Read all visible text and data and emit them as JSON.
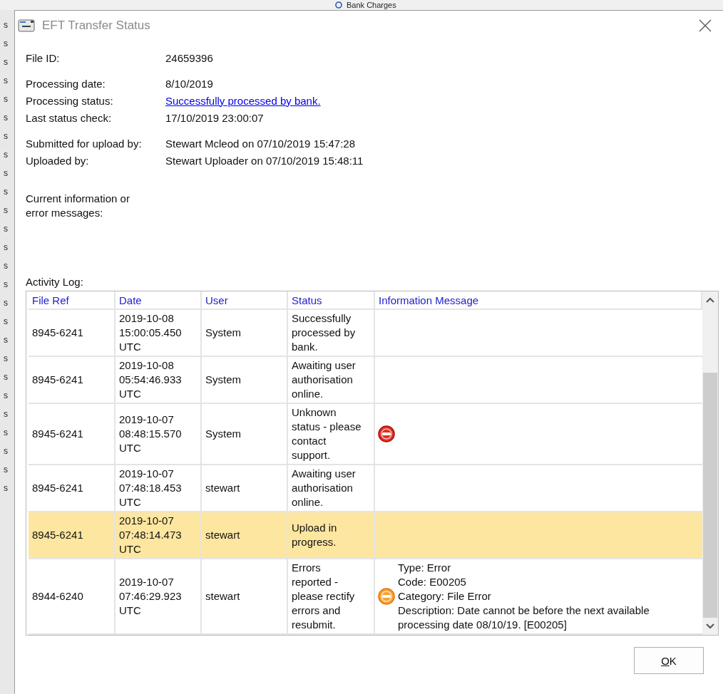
{
  "background_window": {
    "tab": "Bank Charges",
    "items": [
      "s",
      "s",
      "s",
      "s",
      "s",
      "s",
      "s",
      "s",
      "s",
      "s",
      "s",
      "s",
      "s",
      "s",
      "s",
      "s",
      "s",
      "s",
      "s",
      "s",
      "s",
      "s",
      "s",
      "s",
      "s",
      "s"
    ]
  },
  "window": {
    "title": "EFT Transfer Status"
  },
  "field_groups": [
    [
      {
        "label": "File ID:",
        "value": "24659396",
        "kind": "text"
      }
    ],
    [
      {
        "label": "Processing date:",
        "value": "8/10/2019",
        "kind": "text"
      },
      {
        "label": "Processing status:",
        "value": "Successfully processed by bank.",
        "kind": "link"
      },
      {
        "label": "Last status check:",
        "value": "17/10/2019 23:00:07",
        "kind": "text"
      }
    ],
    [
      {
        "label": "Submitted for upload by:",
        "value": "Stewart Mcleod on 07/10/2019 15:47:28",
        "kind": "text"
      },
      {
        "label": "Uploaded by:",
        "value": "Stewart Uploader on 07/10/2019 15:48:11",
        "kind": "text"
      }
    ]
  ],
  "messages_label": "Current information or\nerror messages:",
  "activity_log": {
    "label": "Activity Log:",
    "columns": [
      "File Ref",
      "Date",
      "User",
      "Status",
      "Information Message"
    ],
    "rows": [
      {
        "file_ref": "8945-6241",
        "date": "2019-10-08\n15:00:05.450\nUTC",
        "user": "System",
        "status": "Successfully\nprocessed by\nbank.",
        "kind": "plain",
        "selected": false
      },
      {
        "file_ref": "8945-6241",
        "date": "2019-10-08\n05:54:46.933\nUTC",
        "user": "System",
        "status": "Awaiting user\nauthorisation\nonline.",
        "kind": "plain",
        "selected": false
      },
      {
        "file_ref": "8945-6241",
        "date": "2019-10-07\n08:48:15.570\nUTC",
        "user": "System",
        "status": "Unknown\nstatus - please\ncontact\nsupport.",
        "kind": "error",
        "selected": false
      },
      {
        "file_ref": "8945-6241",
        "date": "2019-10-07\n07:48:18.453\nUTC",
        "user": "stewart",
        "status": "Awaiting user\nauthorisation\nonline.",
        "kind": "plain",
        "selected": false
      },
      {
        "file_ref": "8945-6241",
        "date": "2019-10-07\n07:48:14.473\nUTC",
        "user": "stewart",
        "status": "Upload in\nprogress.",
        "kind": "plain",
        "selected": true
      },
      {
        "file_ref": "8944-6240",
        "date": "2019-10-07\n07:46:29.923\nUTC",
        "user": "stewart",
        "status": "Errors\nreported -\nplease rectify\nerrors and\nresubmit.",
        "kind": "warning",
        "message": "Type: Error\nCode: E00205\nCategory: File Error\nDescription: Date cannot be before the next available\nprocessing date 08/10/19. [E00205]",
        "selected": false
      }
    ]
  },
  "ok_button": {
    "label": "OK"
  }
}
